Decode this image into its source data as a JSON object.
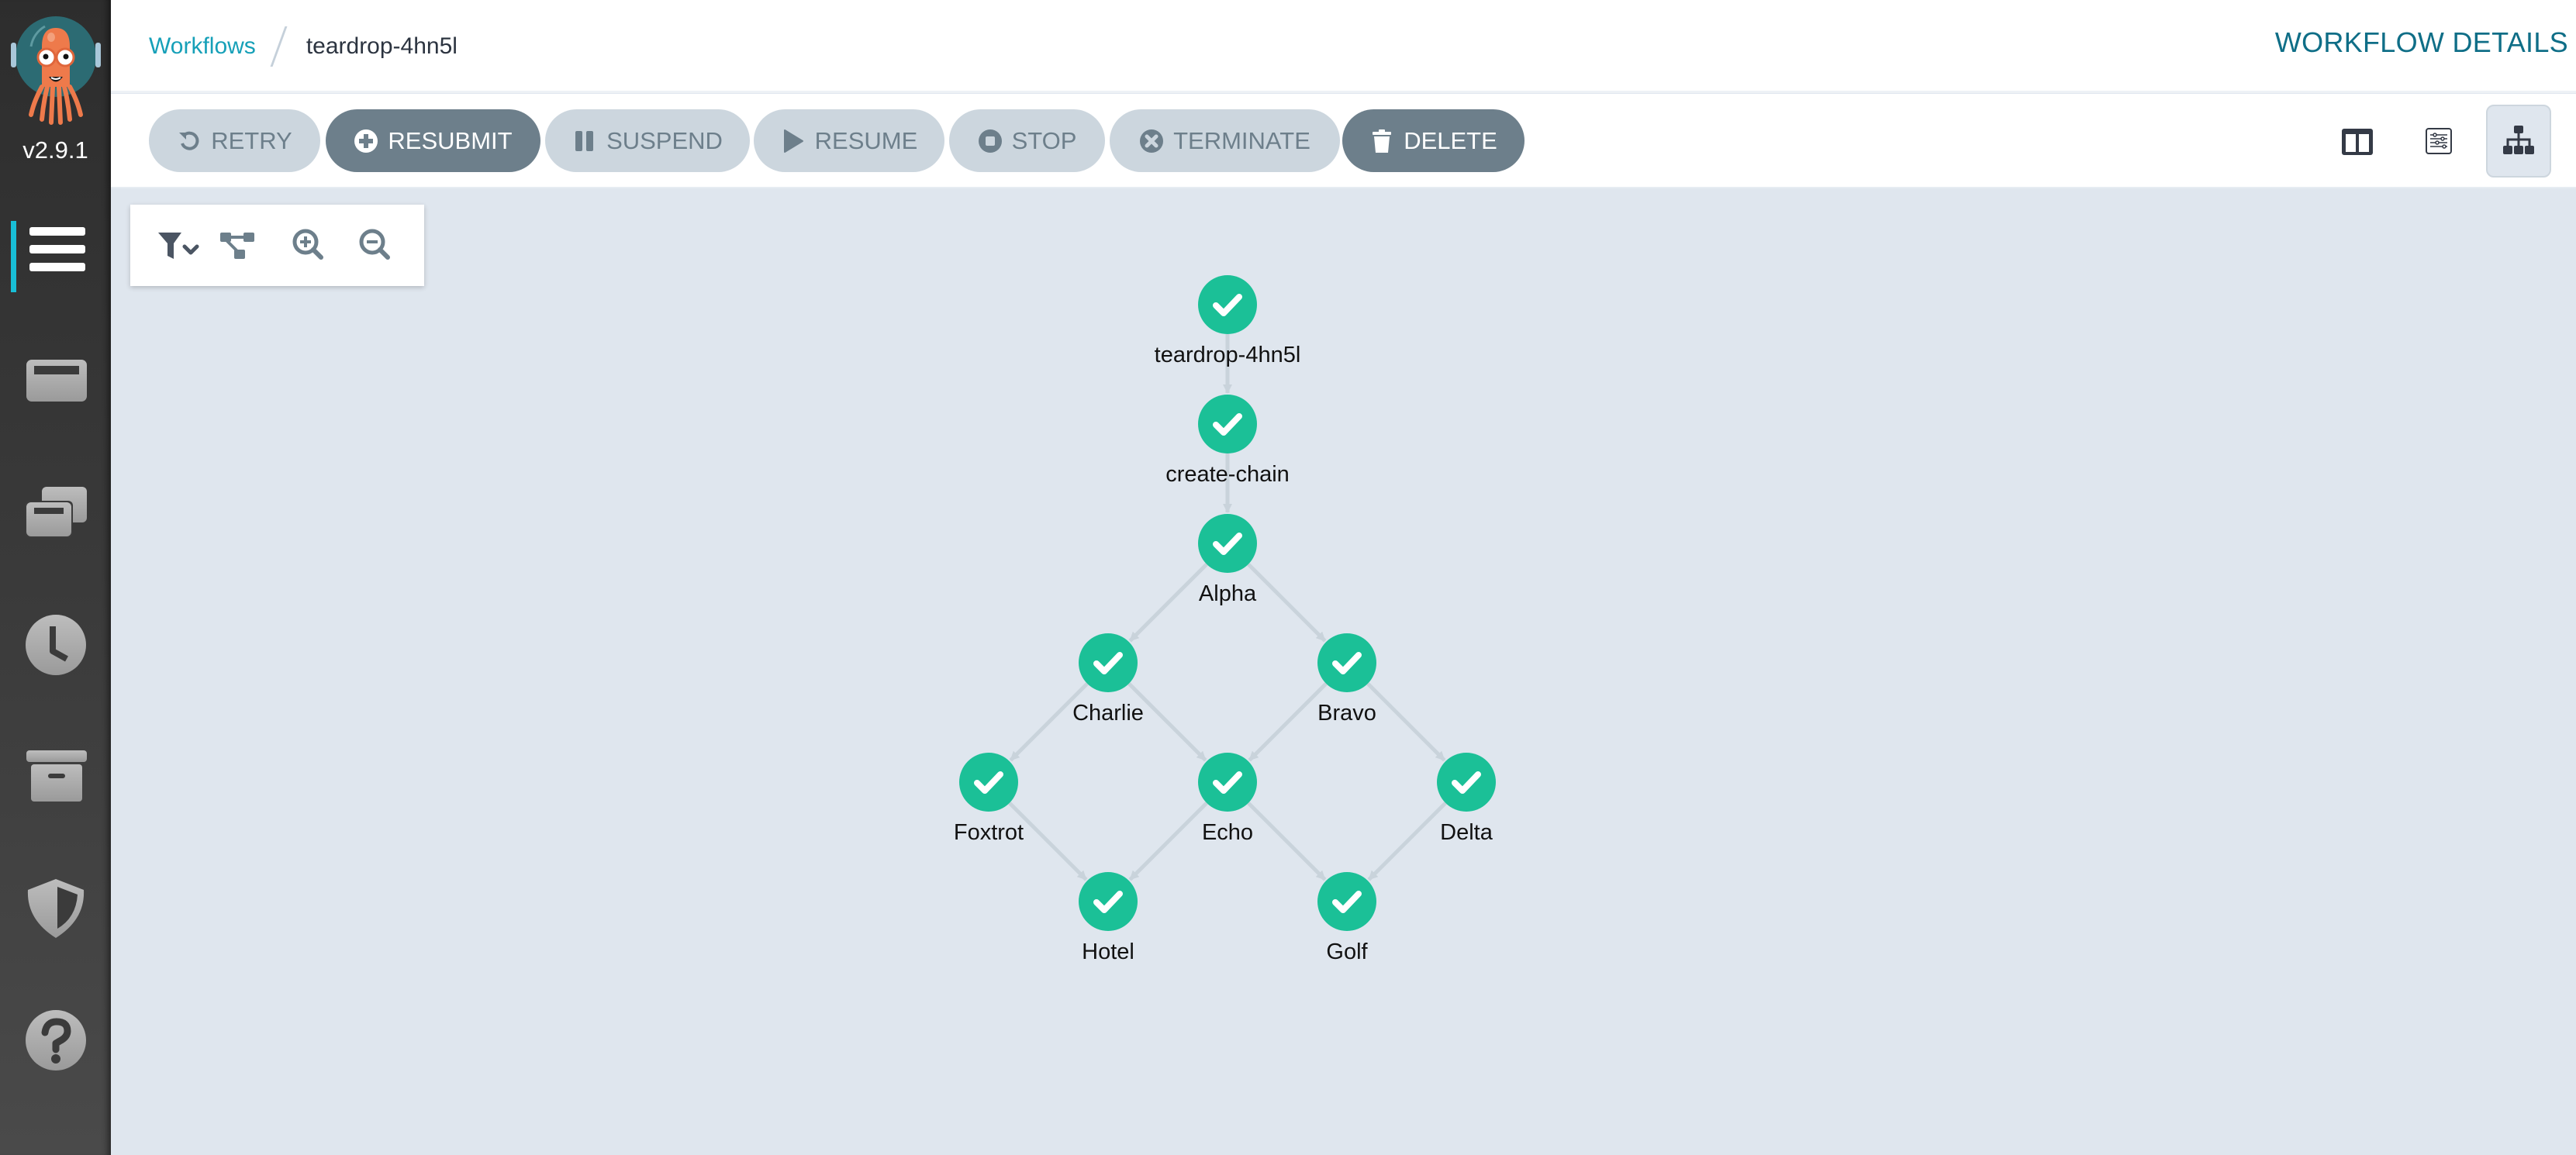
{
  "app": {
    "version": "v2.9.1",
    "logo": "argo-octopus-logo"
  },
  "sidebar": {
    "items": [
      {
        "name": "workflows",
        "icon": "workflows-list-icon",
        "active": true
      },
      {
        "name": "workflow-templates",
        "icon": "window-icon",
        "active": false
      },
      {
        "name": "cluster-workflow-templates",
        "icon": "windows-stack-icon",
        "active": false
      },
      {
        "name": "cron-workflows",
        "icon": "clock-icon",
        "active": false
      },
      {
        "name": "archived-workflows",
        "icon": "archive-box-icon",
        "active": false
      },
      {
        "name": "user-info",
        "icon": "shield-icon",
        "active": false
      },
      {
        "name": "help",
        "icon": "question-circle-icon",
        "active": false
      }
    ]
  },
  "header": {
    "breadcrumb": {
      "link": "Workflows",
      "current": "teardrop-4hn5l"
    },
    "title": "WORKFLOW DETAILS"
  },
  "toolbar": {
    "buttons": [
      {
        "label": "RETRY",
        "icon": "retry-icon",
        "style": "light"
      },
      {
        "label": "RESUBMIT",
        "icon": "plus-circle-icon",
        "style": "dark"
      },
      {
        "label": "SUSPEND",
        "icon": "pause-icon",
        "style": "light"
      },
      {
        "label": "RESUME",
        "icon": "play-icon",
        "style": "light"
      },
      {
        "label": "STOP",
        "icon": "stop-circle-icon",
        "style": "light"
      },
      {
        "label": "TERMINATE",
        "icon": "times-circle-icon",
        "style": "light"
      },
      {
        "label": "DELETE",
        "icon": "trash-icon",
        "style": "dark"
      }
    ],
    "views": [
      {
        "name": "split-view",
        "icon": "columns-icon",
        "active": false
      },
      {
        "name": "summary-view",
        "icon": "sliders-icon",
        "active": false
      },
      {
        "name": "graph-view",
        "icon": "sitemap-icon",
        "active": true
      }
    ]
  },
  "graph_toolbar": {
    "buttons": [
      {
        "name": "filter",
        "icon": "filter-dropdown-icon"
      },
      {
        "name": "layout",
        "icon": "node-layout-icon"
      },
      {
        "name": "zoom-in",
        "icon": "zoom-in-icon"
      },
      {
        "name": "zoom-out",
        "icon": "zoom-out-icon"
      }
    ]
  },
  "workflow_graph": {
    "status_color": "#1bc097",
    "nodes": [
      {
        "id": "teardrop-4hn5l",
        "label": "teardrop-4hn5l",
        "status": "Succeeded",
        "col": 0,
        "row": 0
      },
      {
        "id": "create-chain",
        "label": "create-chain",
        "status": "Succeeded",
        "col": 0,
        "row": 1
      },
      {
        "id": "Alpha",
        "label": "Alpha",
        "status": "Succeeded",
        "col": 0,
        "row": 2
      },
      {
        "id": "Charlie",
        "label": "Charlie",
        "status": "Succeeded",
        "col": -1,
        "row": 3
      },
      {
        "id": "Bravo",
        "label": "Bravo",
        "status": "Succeeded",
        "col": 1,
        "row": 3
      },
      {
        "id": "Foxtrot",
        "label": "Foxtrot",
        "status": "Succeeded",
        "col": -2,
        "row": 4
      },
      {
        "id": "Echo",
        "label": "Echo",
        "status": "Succeeded",
        "col": 0,
        "row": 4
      },
      {
        "id": "Delta",
        "label": "Delta",
        "status": "Succeeded",
        "col": 2,
        "row": 4
      },
      {
        "id": "Hotel",
        "label": "Hotel",
        "status": "Succeeded",
        "col": -1,
        "row": 5
      },
      {
        "id": "Golf",
        "label": "Golf",
        "status": "Succeeded",
        "col": 1,
        "row": 5
      }
    ],
    "edges": [
      [
        "teardrop-4hn5l",
        "create-chain"
      ],
      [
        "create-chain",
        "Alpha"
      ],
      [
        "Alpha",
        "Charlie"
      ],
      [
        "Alpha",
        "Bravo"
      ],
      [
        "Charlie",
        "Foxtrot"
      ],
      [
        "Charlie",
        "Echo"
      ],
      [
        "Bravo",
        "Echo"
      ],
      [
        "Bravo",
        "Delta"
      ],
      [
        "Foxtrot",
        "Hotel"
      ],
      [
        "Echo",
        "Hotel"
      ],
      [
        "Echo",
        "Golf"
      ],
      [
        "Delta",
        "Golf"
      ]
    ]
  }
}
